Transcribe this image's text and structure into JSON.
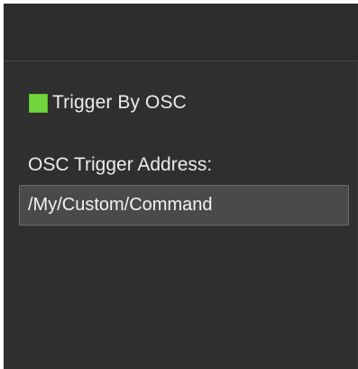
{
  "trigger": {
    "checkbox_checked": true,
    "checkbox_color": "#74d63f",
    "label": "Trigger By OSC"
  },
  "address": {
    "label": "OSC Trigger Address:",
    "value": "/My/Custom/Command"
  }
}
